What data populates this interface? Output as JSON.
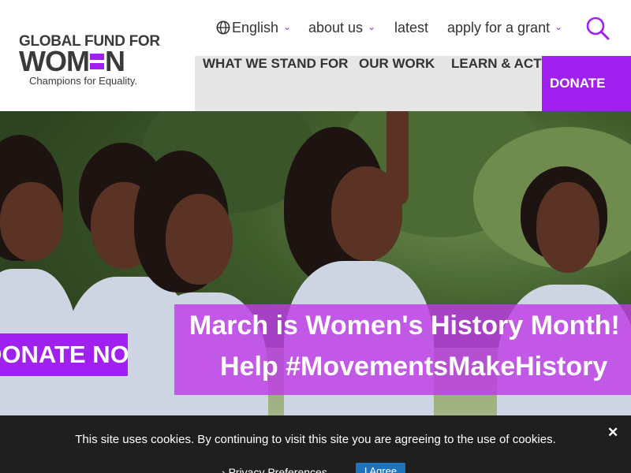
{
  "logo": {
    "line1": "GLOBAL FUND FOR",
    "line2_left": "WOM",
    "line2_right": "N",
    "tagline": "Champions for Equality."
  },
  "topnav": {
    "language": "English",
    "about": "about us",
    "latest": "latest",
    "apply": "apply for a grant",
    "language_icon": "globe-icon",
    "search_icon": "search-icon"
  },
  "mainnav": {
    "items": [
      "WHAT WE STAND FOR",
      "OUR WORK",
      "LEARN & ACT"
    ],
    "donate": "DONATE"
  },
  "hero": {
    "banner_line1": "March is Women's History Month!",
    "banner_line2": "Help #MovementsMakeHistory",
    "donate_now": "DONATE NOW"
  },
  "cookie": {
    "message": "This site uses cookies. By continuing to visit this site you are agreeing to the use of cookies.",
    "preferences": "Privacy Preferences",
    "agree": "I Agree",
    "close": "✕"
  },
  "colors": {
    "brand_purple": "#a020f0",
    "nav_gray": "#e6e6e6",
    "cookie_bg": "#1f1f1f",
    "agree_blue": "#1e73be"
  }
}
